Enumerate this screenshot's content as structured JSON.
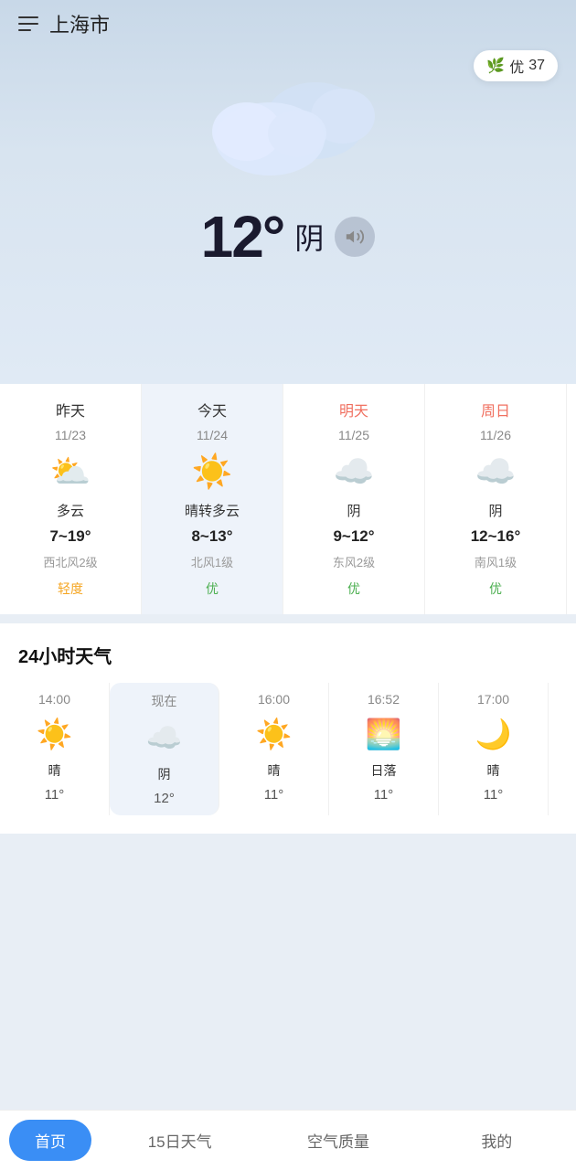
{
  "header": {
    "city": "上海市",
    "menu_icon_label": "menu"
  },
  "air_quality": {
    "label": "优",
    "value": "37"
  },
  "current": {
    "temperature": "12°",
    "condition": "阴",
    "sound_label": "sound"
  },
  "daily": [
    {
      "name": "昨天",
      "name_style": "normal",
      "date": "11/23",
      "icon": "⛅",
      "condition": "多云",
      "temps": "7~19°",
      "wind": "西北风2级",
      "aqi": "轻度",
      "aqi_class": "aqi-moderate"
    },
    {
      "name": "今天",
      "name_style": "normal",
      "date": "11/24",
      "icon": "☀️",
      "condition": "晴转多云",
      "temps": "8~13°",
      "wind": "北风1级",
      "aqi": "优",
      "aqi_class": "aqi-good",
      "is_today": true
    },
    {
      "name": "明天",
      "name_style": "future",
      "date": "11/25",
      "icon": "☁️",
      "condition": "阴",
      "temps": "9~12°",
      "wind": "东风2级",
      "aqi": "优",
      "aqi_class": "aqi-good"
    },
    {
      "name": "周日",
      "name_style": "future",
      "date": "11/26",
      "icon": "☁️",
      "condition": "阴",
      "temps": "12~16°",
      "wind": "南风1级",
      "aqi": "优",
      "aqi_class": "aqi-good"
    }
  ],
  "hourly_title": "24小时天气",
  "hourly": [
    {
      "time": "14:00",
      "icon": "☀️",
      "condition": "晴",
      "temp": "11°",
      "is_now": false
    },
    {
      "time": "现在",
      "icon": "☁️",
      "condition": "阴",
      "temp": "12°",
      "is_now": true
    },
    {
      "time": "16:00",
      "icon": "☀️",
      "condition": "晴",
      "temp": "11°",
      "is_now": false
    },
    {
      "time": "16:52",
      "icon": "🌅",
      "condition": "日落",
      "temp": "11°",
      "is_now": false
    },
    {
      "time": "17:00",
      "icon": "🌙",
      "condition": "晴",
      "temp": "11°",
      "is_now": false
    }
  ],
  "bottom_nav": [
    {
      "label": "首页",
      "active": true
    },
    {
      "label": "15日天气",
      "active": false
    },
    {
      "label": "空气质量",
      "active": false
    },
    {
      "label": "我的",
      "active": false
    }
  ]
}
